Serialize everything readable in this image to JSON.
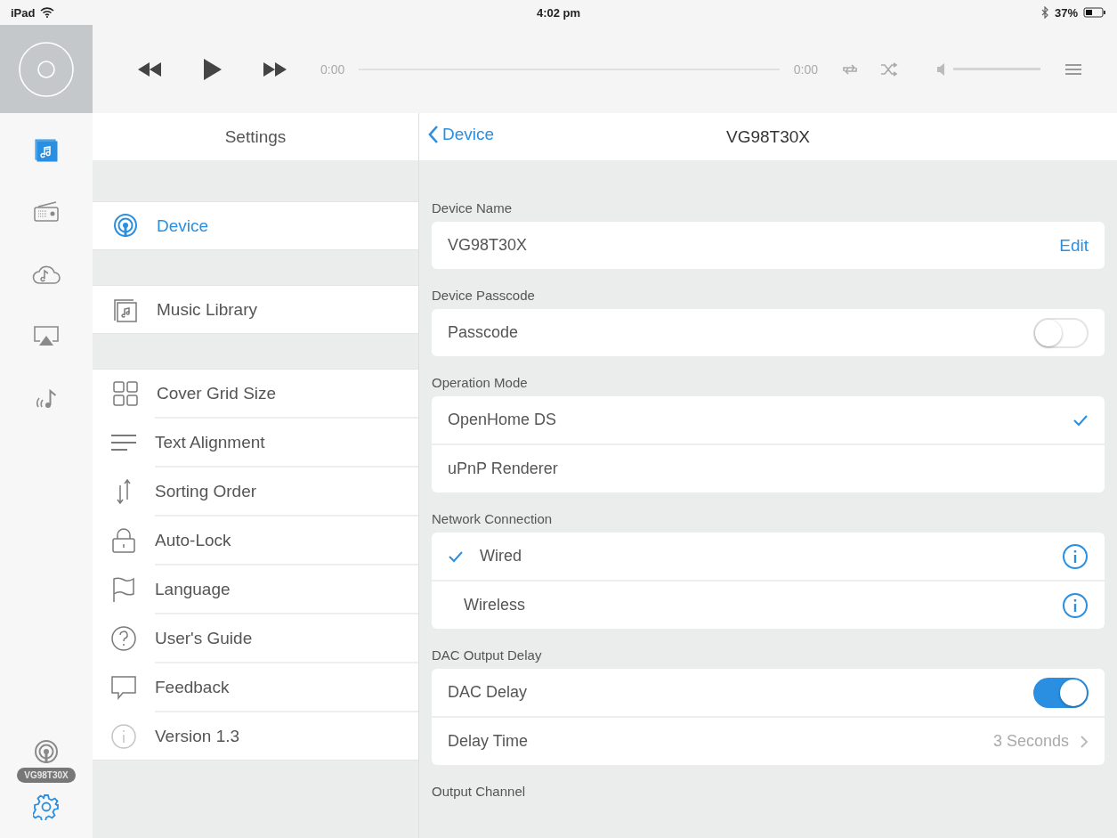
{
  "status_bar": {
    "device": "iPad",
    "time": "4:02 pm",
    "battery": "37%"
  },
  "player": {
    "elapsed": "0:00",
    "duration": "0:00"
  },
  "rail": {
    "items": [
      {
        "kind": "music",
        "selected": true
      },
      {
        "kind": "radio",
        "selected": false
      },
      {
        "kind": "cloud",
        "selected": false
      },
      {
        "kind": "airplay",
        "selected": false
      },
      {
        "kind": "wireless",
        "selected": false
      }
    ],
    "device_badge": "VG98T30X",
    "settings_selected": true
  },
  "settings": {
    "title": "Settings",
    "groups": [
      [
        {
          "kind": "device",
          "label": "Device",
          "selected": true
        }
      ],
      [
        {
          "kind": "library",
          "label": "Music Library",
          "selected": false
        }
      ],
      [
        {
          "kind": "grid",
          "label": "Cover Grid Size",
          "selected": false
        },
        {
          "kind": "align",
          "label": "Text Alignment",
          "selected": false
        },
        {
          "kind": "sort",
          "label": "Sorting Order",
          "selected": false
        },
        {
          "kind": "lock",
          "label": "Auto-Lock",
          "selected": false
        },
        {
          "kind": "flag",
          "label": "Language",
          "selected": false
        },
        {
          "kind": "help",
          "label": "User's Guide",
          "selected": false
        },
        {
          "kind": "chat",
          "label": "Feedback",
          "selected": false
        },
        {
          "kind": "info",
          "label": "Version 1.3",
          "selected": false
        }
      ]
    ]
  },
  "detail": {
    "back": "Device",
    "title": "VG98T30X",
    "sections": [
      {
        "label": "Device Name",
        "rows": [
          {
            "kind": "edit",
            "label": "VG98T30X",
            "action": "Edit"
          }
        ]
      },
      {
        "label": "Device Passcode",
        "rows": [
          {
            "kind": "toggle",
            "label": "Passcode",
            "on": false
          }
        ]
      },
      {
        "label": "Operation Mode",
        "rows": [
          {
            "kind": "choice",
            "label": "OpenHome DS",
            "selected": true
          },
          {
            "kind": "choice",
            "label": "uPnP Renderer",
            "selected": false
          }
        ]
      },
      {
        "label": "Network Connection",
        "rows": [
          {
            "kind": "network",
            "label": "Wired",
            "selected": true
          },
          {
            "kind": "network",
            "label": "Wireless",
            "selected": false
          }
        ]
      },
      {
        "label": "DAC Output Delay",
        "rows": [
          {
            "kind": "toggle",
            "label": "DAC Delay",
            "on": true
          },
          {
            "kind": "value",
            "label": "Delay Time",
            "value": "3 Seconds"
          }
        ]
      },
      {
        "label": "Output Channel"
      }
    ]
  }
}
